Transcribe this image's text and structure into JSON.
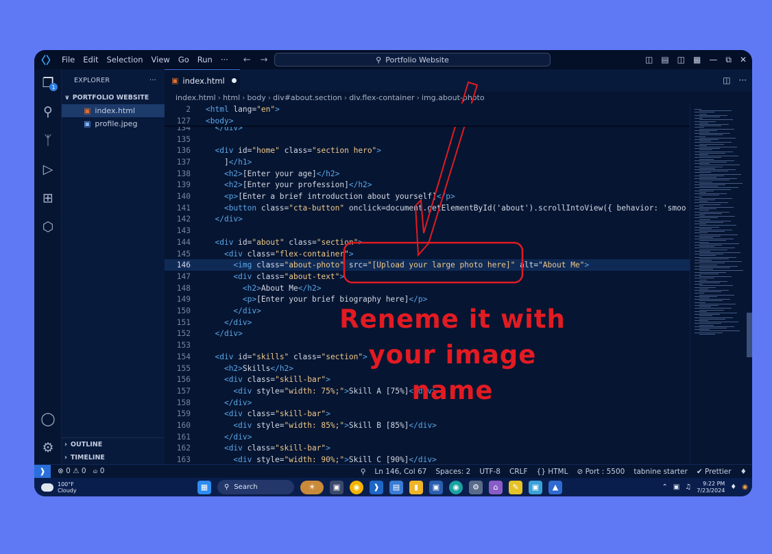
{
  "titlebar": {
    "menu": [
      "File",
      "Edit",
      "Selection",
      "View",
      "Go",
      "Run",
      "···"
    ],
    "search": "Portfolio Website"
  },
  "sidebar": {
    "header": "EXPLORER",
    "more": "···",
    "folder": "PORTFOLIO WEBSITE",
    "files": [
      "index.html",
      "profile.jpeg"
    ],
    "outline": "OUTLINE",
    "timeline": "TIMELINE",
    "badge": "1"
  },
  "tab": {
    "label": "index.html"
  },
  "breadcrumb": [
    "index.html",
    "html",
    "body",
    "div#about.section",
    "div.flex-container",
    "img.about-photo"
  ],
  "sticky": [
    {
      "num": "2",
      "code": "<html lang=\"en\">"
    },
    {
      "num": "127",
      "code": "<body>"
    }
  ],
  "lines": [
    {
      "num": "134",
      "code": "  </div>"
    },
    {
      "num": "135",
      "code": ""
    },
    {
      "num": "136",
      "code": "  <div id=\"home\" class=\"section hero\">"
    },
    {
      "num": "137",
      "code": "    ]</h1>"
    },
    {
      "num": "138",
      "code": "    <h2>[Enter your age]</h2>"
    },
    {
      "num": "139",
      "code": "    <h2>[Enter your profession]</h2>"
    },
    {
      "num": "140",
      "code": "    <p>[Enter a brief introduction about yourself]</p>"
    },
    {
      "num": "141",
      "code": "    <button class=\"cta-button\" onclick=\"document.getElementById('about').scrollIntoView({ behavior: 'smoo"
    },
    {
      "num": "142",
      "code": "  </div>"
    },
    {
      "num": "143",
      "code": ""
    },
    {
      "num": "144",
      "code": "  <div id=\"about\" class=\"section\">"
    },
    {
      "num": "145",
      "code": "    <div class=\"flex-container\">"
    },
    {
      "num": "146",
      "code": "      <img class=\"about-photo\" src=\"[Upload your large photo here]\" alt=\"About Me\">"
    },
    {
      "num": "147",
      "code": "      <div class=\"about-text\">"
    },
    {
      "num": "148",
      "code": "        <h2>About Me</h2>"
    },
    {
      "num": "149",
      "code": "        <p>[Enter your brief biography here]</p>"
    },
    {
      "num": "150",
      "code": "      </div>"
    },
    {
      "num": "151",
      "code": "    </div>"
    },
    {
      "num": "152",
      "code": "  </div>"
    },
    {
      "num": "153",
      "code": ""
    },
    {
      "num": "154",
      "code": "  <div id=\"skills\" class=\"section\">"
    },
    {
      "num": "155",
      "code": "    <h2>Skills</h2>"
    },
    {
      "num": "156",
      "code": "    <div class=\"skill-bar\">"
    },
    {
      "num": "157",
      "code": "      <div style=\"width: 75%;\">Skill A [75%]</div>"
    },
    {
      "num": "158",
      "code": "    </div>"
    },
    {
      "num": "159",
      "code": "    <div class=\"skill-bar\">"
    },
    {
      "num": "160",
      "code": "      <div style=\"width: 85%;\">Skill B [85%]</div>"
    },
    {
      "num": "161",
      "code": "    </div>"
    },
    {
      "num": "162",
      "code": "    <div class=\"skill-bar\">"
    },
    {
      "num": "163",
      "code": "      <div style=\"width: 90%;\">Skill C [90%]</div>"
    }
  ],
  "statusbar": {
    "problems": "⊗ 0 ⚠ 0",
    "ports_icon": "௰ 0",
    "position": "Ln 146, Col 67",
    "spaces": "Spaces: 2",
    "encoding": "UTF-8",
    "eol": "CRLF",
    "language": "{} HTML",
    "port": "⊘ Port : 5500",
    "tabnine": "tabnine starter",
    "prettier": "✔ Prettier"
  },
  "taskbar": {
    "temp": "100°F",
    "weather": "Cloudy",
    "search": "Search",
    "time": "9:22 PM",
    "date": "7/23/2024"
  },
  "annotation": {
    "line1": "Reneme it with",
    "line2": "your image",
    "line3": "name"
  },
  "colors": {
    "background": "#5f79f5",
    "annotation": "#e21b22",
    "accent": "#2a6fdb"
  }
}
